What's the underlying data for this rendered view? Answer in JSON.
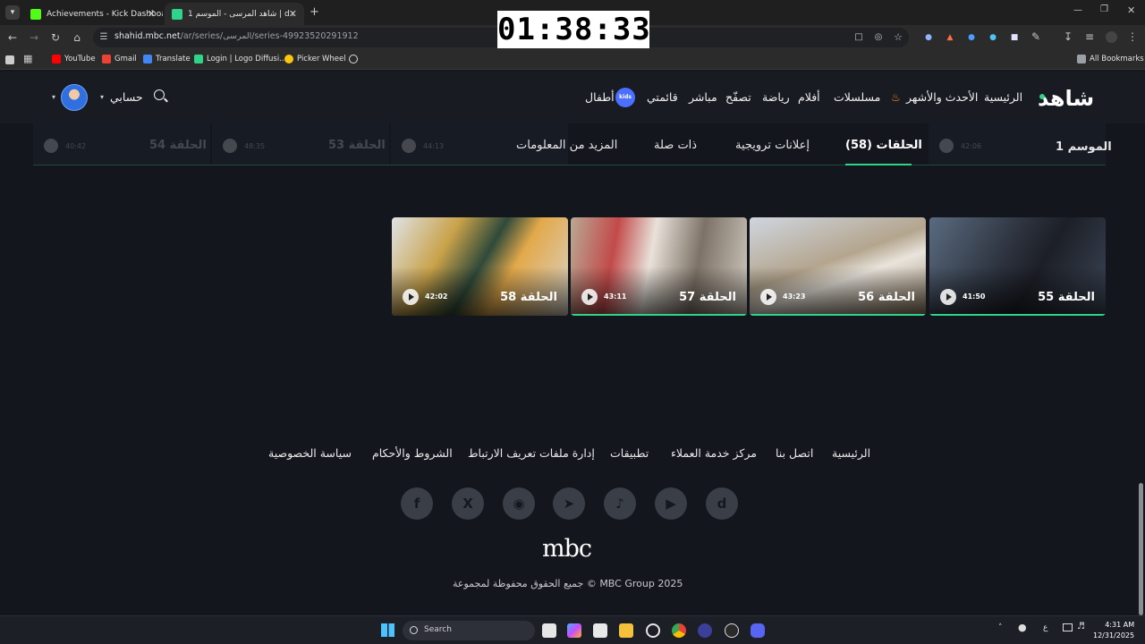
{
  "browser": {
    "tabs": [
      {
        "label": "Achievements - Kick Dashboard",
        "active": false
      },
      {
        "label": "شاهد المرسى - الموسم 1 | d.net",
        "active": true
      }
    ],
    "new_tab_icon": "plus-icon",
    "url_host": "shahid.mbc.net",
    "url_path": "/ar/series/المرسى/series-49923520291912",
    "bookmarks": [
      "YouTube",
      "Gmail",
      "Translate",
      "Login | Logo Diffusi...",
      "Picker Wheel"
    ],
    "all_bookmarks": "All Bookmarks"
  },
  "overlay": {
    "timer": "01:38:33"
  },
  "site": {
    "logo": "شاهد",
    "nav": [
      "الرئيسية",
      "الأحدث والأشهر",
      "مسلسلات",
      "أفلام",
      "رياضة",
      "تصفّح",
      "مباشر",
      "قائمتي",
      "أطفال"
    ],
    "kids_badge": "kids",
    "account_label": "حسابي",
    "accent_color": "#2fd38a"
  },
  "content": {
    "season_label": "الموسم 1",
    "tabs": [
      "الحلقات (58)",
      "إعلانات ترويجية",
      "ذات صلة",
      "المزيد من المعلومات"
    ],
    "ghost_episodes": [
      {
        "title": "الحلقة 54",
        "duration": "40:42"
      },
      {
        "title": "الحلقة 53",
        "duration": "48:35"
      },
      {
        "title": "",
        "duration": "44:13"
      },
      {
        "title": "",
        "duration": "42:06"
      }
    ],
    "episodes": [
      {
        "title": "الحلقة 55",
        "duration": "41:50",
        "progress": 1.0
      },
      {
        "title": "الحلقة 56",
        "duration": "43:23",
        "progress": 1.0
      },
      {
        "title": "الحلقة 57",
        "duration": "43:11",
        "progress": 1.0
      },
      {
        "title": "الحلقة 58",
        "duration": "42:02",
        "progress": 0
      }
    ]
  },
  "footer": {
    "links": [
      "الرئيسية",
      "اتصل بنا",
      "مركز خدمة العملاء",
      "تطبيقات",
      "إدارة ملفات تعريف الارتباط",
      "الشروط والأحكام",
      "سياسة الخصوصية"
    ],
    "social_icons": [
      "shahid-icon",
      "youtube-icon",
      "tiktok-icon",
      "telegram-icon",
      "instagram-icon",
      "x-icon",
      "facebook-icon"
    ],
    "brand": "mbc",
    "copyright": "جميع الحقوق محفوظة لمجموعة © MBC Group 2025"
  },
  "taskbar": {
    "search_placeholder": "Search",
    "time": "4:31 AM",
    "date": "12/31/2025",
    "lang": "ع"
  }
}
